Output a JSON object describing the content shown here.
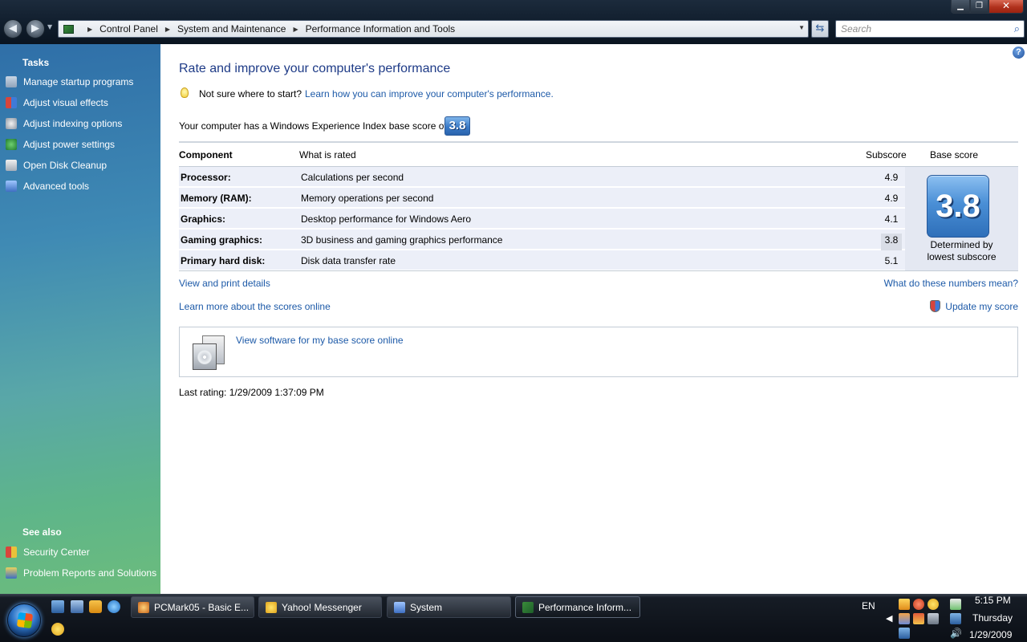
{
  "window": {
    "breadcrumbs": [
      "Control Panel",
      "System and Maintenance",
      "Performance Information and Tools"
    ],
    "search_placeholder": "Search"
  },
  "sidebar": {
    "tasks_heading": "Tasks",
    "tasks": [
      {
        "label": "Manage startup programs",
        "icon": "startup-programs-icon"
      },
      {
        "label": "Adjust visual effects",
        "icon": "uac-shield-icon"
      },
      {
        "label": "Adjust indexing options",
        "icon": "indexing-icon"
      },
      {
        "label": "Adjust power settings",
        "icon": "power-icon"
      },
      {
        "label": "Open Disk Cleanup",
        "icon": "disk-cleanup-icon"
      },
      {
        "label": "Advanced tools",
        "icon": "advanced-tools-icon"
      }
    ],
    "see_also_heading": "See also",
    "see_also": [
      {
        "label": "Security Center",
        "icon": "security-center-icon"
      },
      {
        "label": "Problem Reports and Solutions",
        "icon": "problem-reports-icon"
      }
    ]
  },
  "main": {
    "title": "Rate and improve your computer's performance",
    "hint_text": "Not sure where to start?",
    "hint_link": "Learn how you can improve your computer's performance.",
    "score_sentence": "Your computer has a Windows Experience Index base score of",
    "base_score": "3.8",
    "table": {
      "headers": {
        "component": "Component",
        "rated": "What is rated",
        "subscore": "Subscore",
        "base": "Base score"
      },
      "rows": [
        {
          "component": "Processor:",
          "rated": "Calculations per second",
          "subscore": "4.9"
        },
        {
          "component": "Memory (RAM):",
          "rated": "Memory operations per second",
          "subscore": "4.9"
        },
        {
          "component": "Graphics:",
          "rated": "Desktop performance for Windows Aero",
          "subscore": "4.1"
        },
        {
          "component": "Gaming graphics:",
          "rated": "3D business and gaming graphics performance",
          "subscore": "3.8"
        },
        {
          "component": "Primary hard disk:",
          "rated": "Disk data transfer rate",
          "subscore": "5.1"
        }
      ],
      "base_caption_1": "Determined by",
      "base_caption_2": "lowest subscore"
    },
    "links": {
      "view_print": "View and print details",
      "what_mean": "What do these numbers mean?",
      "learn_more": "Learn more about the scores online",
      "update_score": "Update my score",
      "software": "View software for my base score online"
    },
    "last_rating": "Last rating: 1/29/2009 1:37:09 PM"
  },
  "taskbar": {
    "tasks": [
      {
        "label": "PCMark05 - Basic E...",
        "active": false
      },
      {
        "label": "Yahoo! Messenger",
        "active": false
      },
      {
        "label": "System",
        "active": false
      },
      {
        "label": "Performance Inform...",
        "active": true
      }
    ],
    "language": "EN",
    "clock": {
      "time": "5:15 PM",
      "day": "Thursday",
      "date": "1/29/2009"
    }
  },
  "colors": {
    "link": "#1d5aa8",
    "title": "#1e3b87",
    "row_bg": "#eceff8",
    "badge": "#3a7bc8"
  }
}
